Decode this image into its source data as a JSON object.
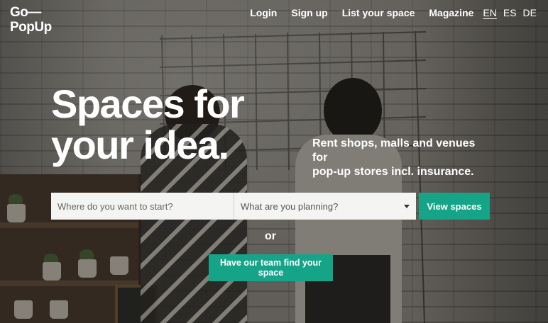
{
  "brand": {
    "logo_line1": "Go—",
    "logo_line2": "PopUp"
  },
  "nav": {
    "login": "Login",
    "signup": "Sign up",
    "list_space": "List your space",
    "magazine": "Magazine",
    "languages": [
      "EN",
      "ES",
      "DE"
    ],
    "active_language": "EN"
  },
  "hero": {
    "headline_line1": "Spaces for",
    "headline_line2": "your idea.",
    "subline_line1": "Rent shops, malls and venues for",
    "subline_line2": "pop-up stores incl. insurance."
  },
  "search": {
    "where_placeholder": "Where do you want to start?",
    "what_value": "What are you planning?",
    "view_button": "View spaces",
    "or_text": "or",
    "team_button": "Have our team find your space"
  },
  "colors": {
    "accent": "#16a488",
    "text": "#ffffff"
  }
}
